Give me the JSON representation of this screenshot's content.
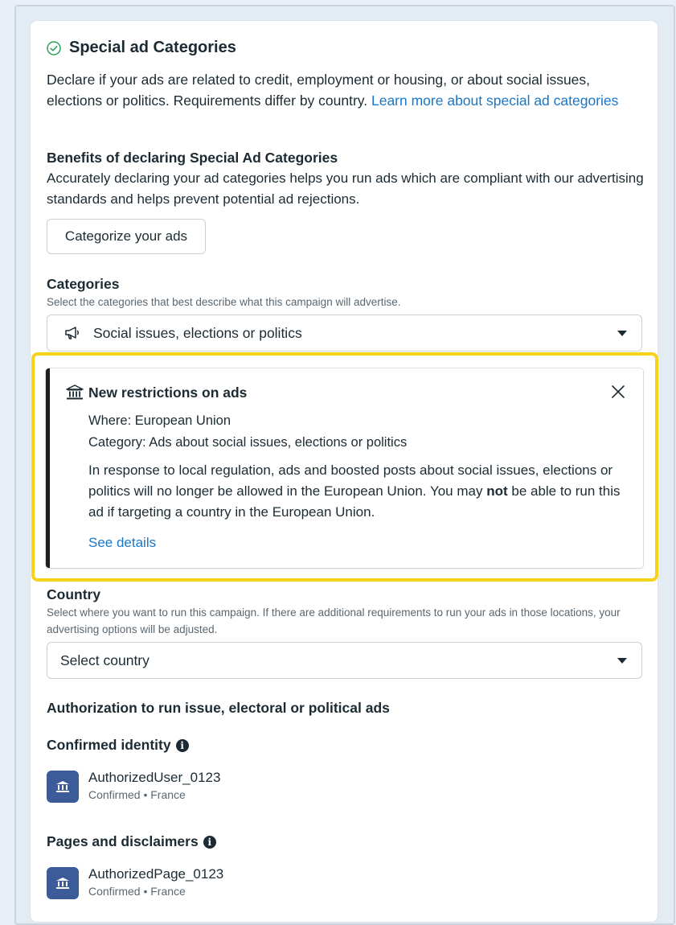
{
  "section": {
    "title": "Special ad Categories",
    "intro_text": "Declare if your ads are related to credit, employment or housing, or about social issues, elections or politics. Requirements differ by country. ",
    "intro_link": "Learn more about special ad categories"
  },
  "benefits": {
    "heading": "Benefits of declaring Special Ad Categories",
    "text": "Accurately declaring your ad categories helps you run ads which are compliant with our advertising standards and helps prevent potential ad rejections.",
    "button_label": "Categorize your ads"
  },
  "categories": {
    "heading": "Categories",
    "helper": "Select the categories that best describe what this campaign will advertise.",
    "selected_value": "Social issues, elections or politics",
    "selected_icon": "megaphone-icon"
  },
  "notice": {
    "icon": "government-building-icon",
    "title": "New restrictions on ads",
    "where": "Where: European Union",
    "category": "Category: Ads about social issues, elections or politics",
    "body_part1": "In response to local regulation, ads and boosted posts about social issues, elections or politics will no longer be allowed in the European Union. You may ",
    "body_bold": "not",
    "body_part2": " be able to run this ad if targeting a country in the European Union.",
    "link": "See details",
    "close_icon": "close-icon",
    "highlight_color": "#f6d21a"
  },
  "country": {
    "heading": "Country",
    "helper": "Select where you want to run this campaign. If there are additional requirements to run your ads in those locations, your advertising options will be adjusted.",
    "placeholder": "Select country"
  },
  "authorization": {
    "heading": "Authorization to run issue, electoral or political ads",
    "identity_heading": "Confirmed identity",
    "identity_name": "AuthorizedUser_0123",
    "identity_status": "Confirmed • France",
    "pages_heading": "Pages and disclaimers",
    "page_name": "AuthorizedPage_0123",
    "page_status": "Confirmed • France"
  },
  "colors": {
    "link": "#1877c9",
    "text": "#1c2b33",
    "badge": "#3b5b99"
  }
}
